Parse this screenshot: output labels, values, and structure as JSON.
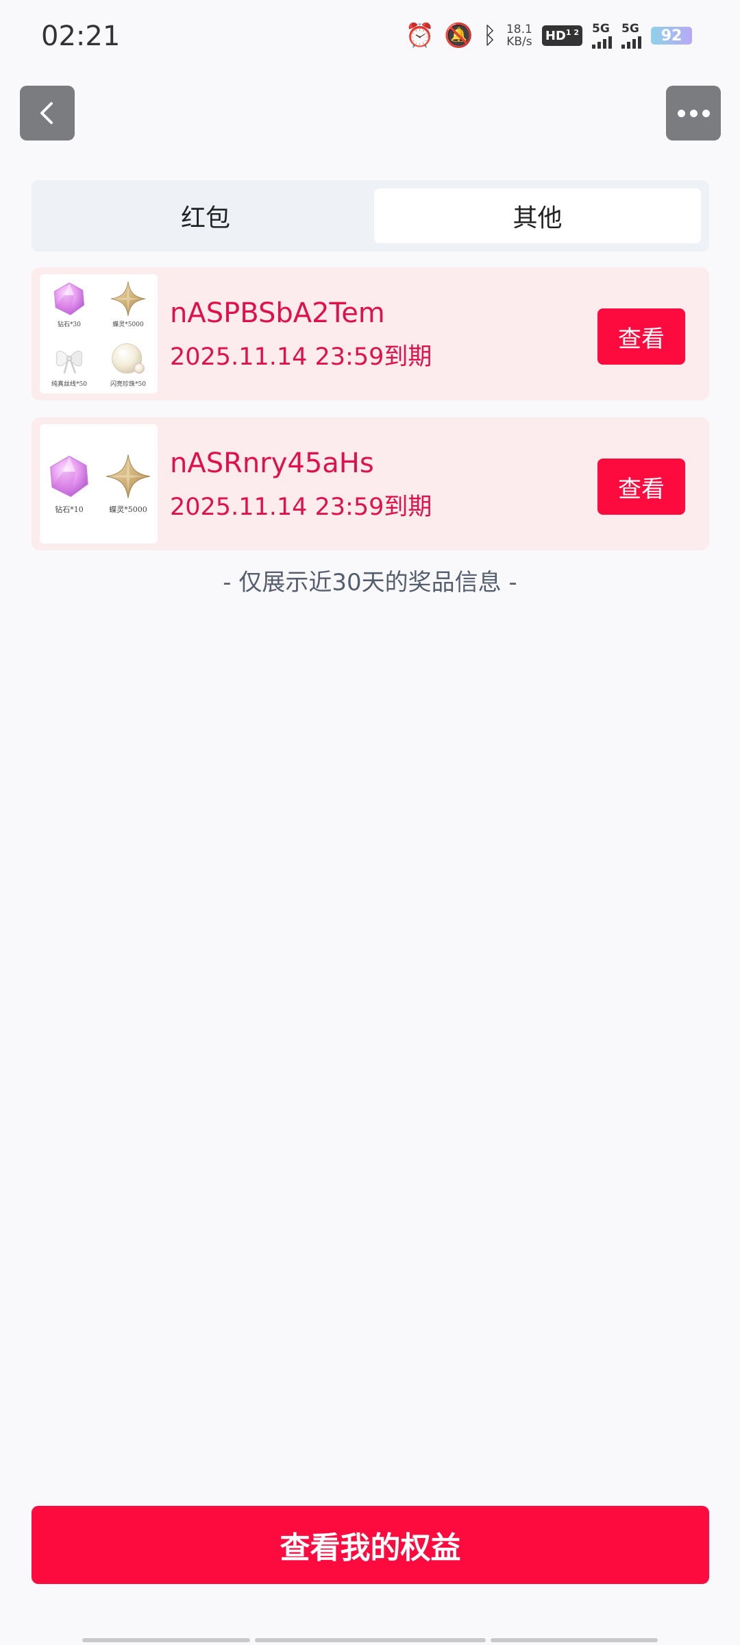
{
  "status_bar": {
    "time": "02:21",
    "net_speed_value": "18.1",
    "net_speed_unit": "KB/s",
    "hd_label": "HD",
    "hd_sub": "1 2",
    "sim1": "5G",
    "sim2": "5G",
    "battery": "92",
    "icons": [
      "alarm-icon",
      "mute-bell-icon",
      "bluetooth-icon"
    ]
  },
  "nav": {
    "back_icon": "chevron-left-icon",
    "more_icon": "more-dots-icon"
  },
  "tabs": [
    {
      "label": "红包",
      "selected": false
    },
    {
      "label": "其他",
      "selected": true
    }
  ],
  "rewards": [
    {
      "code": "nASPBSbA2Tem",
      "expiry": "2025.11.14 23:59到期",
      "view_label": "查看",
      "prizes": [
        {
          "icon": "pink-diamond-icon",
          "label": "钻石*30"
        },
        {
          "icon": "gold-butterfly-star-icon",
          "label": "蝶灵*5000"
        },
        {
          "icon": "white-bow-icon",
          "label": "纯真丝线*50"
        },
        {
          "icon": "pearl-icon",
          "label": "闪亮珍珠*50"
        }
      ]
    },
    {
      "code": "nASRnry45aHs",
      "expiry": "2025.11.14 23:59到期",
      "view_label": "查看",
      "prizes": [
        {
          "icon": "pink-diamond-icon",
          "label": "钻石*10"
        },
        {
          "icon": "gold-butterfly-star-icon",
          "label": "蝶灵*5000"
        }
      ]
    }
  ],
  "notice": "- 仅展示近30天的奖品信息 -",
  "cta_label": "查看我的权益",
  "colors": {
    "accent": "#fd0a3f",
    "card_bg": "#fdeced",
    "text_accent": "#e0104a",
    "nav_button": "#7a7c80"
  }
}
